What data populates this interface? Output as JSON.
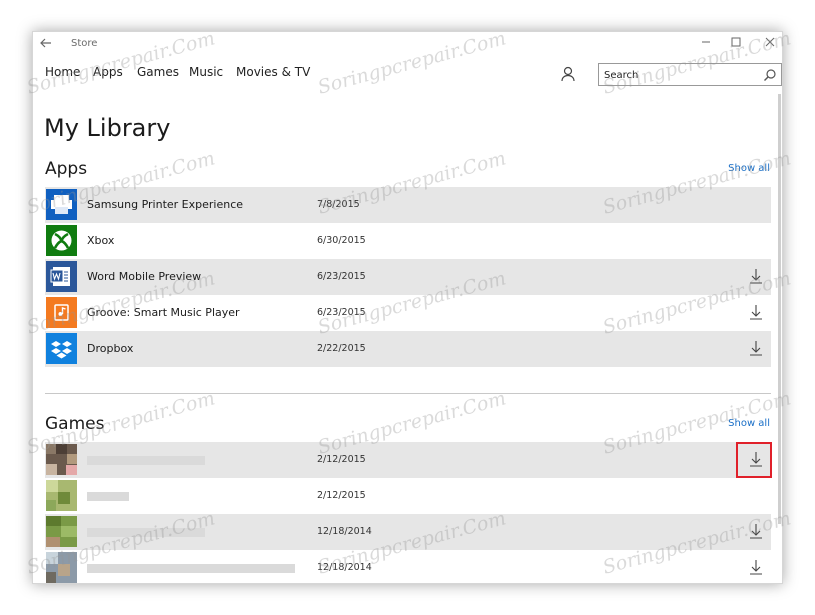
{
  "window": {
    "title": "Store"
  },
  "nav": {
    "items": [
      {
        "label": "Home"
      },
      {
        "label": "Apps"
      },
      {
        "label": "Games"
      },
      {
        "label": "Music"
      },
      {
        "label": "Movies & TV"
      }
    ]
  },
  "search": {
    "placeholder": "Search"
  },
  "page": {
    "title": "My Library"
  },
  "apps": {
    "title": "Apps",
    "show_all": "Show all",
    "rows": [
      {
        "name": "Samsung Printer Experience",
        "date": "7/8/2015",
        "icon": "printer-icon",
        "color": "#1060c0",
        "downloadable": false
      },
      {
        "name": "Xbox",
        "date": "6/30/2015",
        "icon": "xbox-icon",
        "color": "#107c10",
        "downloadable": false
      },
      {
        "name": "Word Mobile Preview",
        "date": "6/23/2015",
        "icon": "word-icon",
        "color": "#2b579a",
        "downloadable": true
      },
      {
        "name": "Groove: Smart Music Player",
        "date": "6/23/2015",
        "icon": "music-icon",
        "color": "#f47a20",
        "downloadable": true
      },
      {
        "name": "Dropbox",
        "date": "2/22/2015",
        "icon": "dropbox-icon",
        "color": "#1081de",
        "downloadable": true
      }
    ]
  },
  "games": {
    "title": "Games",
    "show_all": "Show all",
    "rows": [
      {
        "date": "2/12/2015",
        "downloadable": true
      },
      {
        "date": "2/12/2015",
        "downloadable": false
      },
      {
        "date": "12/18/2014",
        "downloadable": true
      },
      {
        "date": "12/18/2014",
        "downloadable": true
      }
    ]
  },
  "watermark": "Soringpcrepair.Com",
  "colors": {
    "accent": "#1a6fc7",
    "highlight": "#e0202a"
  }
}
